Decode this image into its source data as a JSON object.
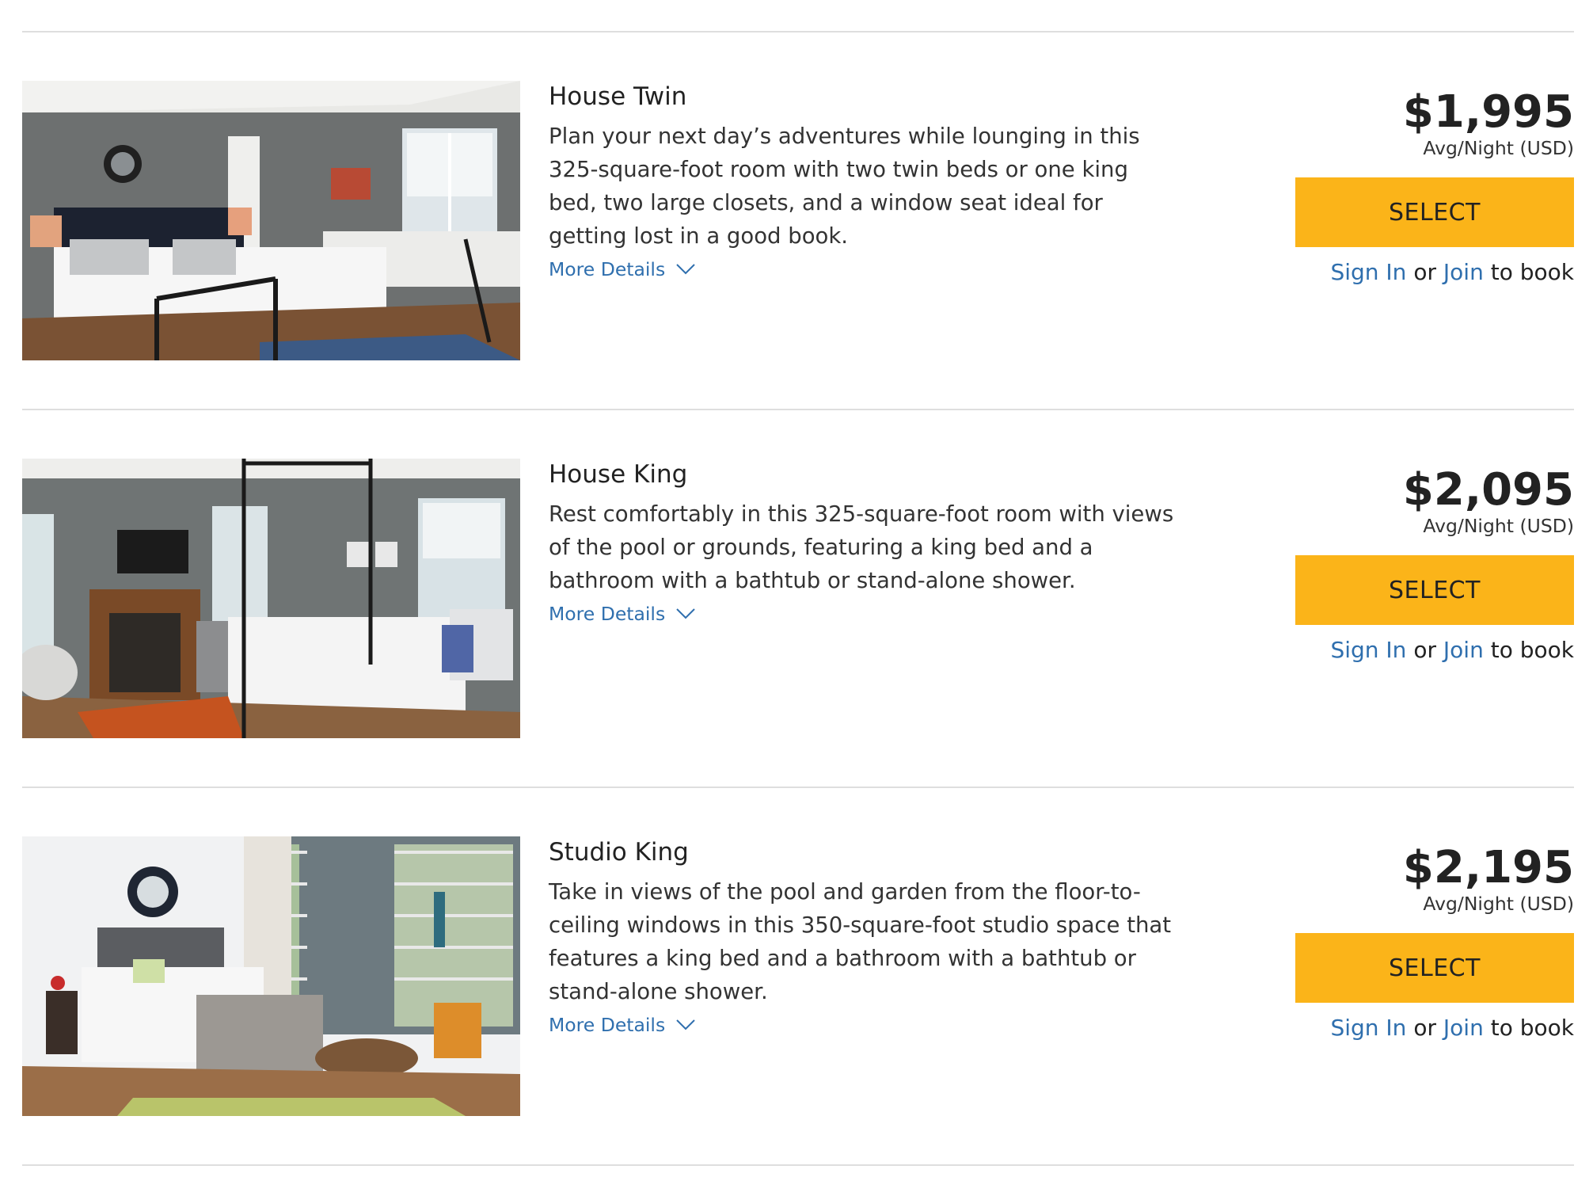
{
  "rooms": [
    {
      "name": "House Twin",
      "description": "Plan your next day’s adventures while lounging in this 325-square-foot room with two twin beds or one king bed, two large closets, and a window seat ideal for getting lost in a good book.",
      "more_details": "More Details",
      "price": "$1,995",
      "price_note": "Avg/Night (USD)",
      "select_label": "SELECT",
      "sign_in": "Sign In",
      "or": "or",
      "join": "Join",
      "to_book": "to book"
    },
    {
      "name": "House King",
      "description": "Rest comfortably in this 325-square-foot room with views of the pool or grounds, featuring a king bed and a bathroom with a bathtub or stand-alone shower.",
      "more_details": "More Details",
      "price": "$2,095",
      "price_note": "Avg/Night (USD)",
      "select_label": "SELECT",
      "sign_in": "Sign In",
      "or": "or",
      "join": "Join",
      "to_book": "to book"
    },
    {
      "name": "Studio King",
      "description": "Take in views of the pool and garden from the floor-to-ceiling windows in this 350-square-foot studio space that features a king bed and a bathroom with a bathtub or stand-alone shower.",
      "more_details": "More Details",
      "price": "$2,195",
      "price_note": "Avg/Night (USD)",
      "select_label": "SELECT",
      "sign_in": "Sign In",
      "or": "or",
      "join": "Join",
      "to_book": "to book"
    }
  ],
  "colors": {
    "select_button": "#fbb419",
    "link": "#2f6fae",
    "divider": "#dedede",
    "text": "#222222"
  },
  "icons": {
    "photo": "room-photo",
    "expand": "chevron-down-icon"
  }
}
